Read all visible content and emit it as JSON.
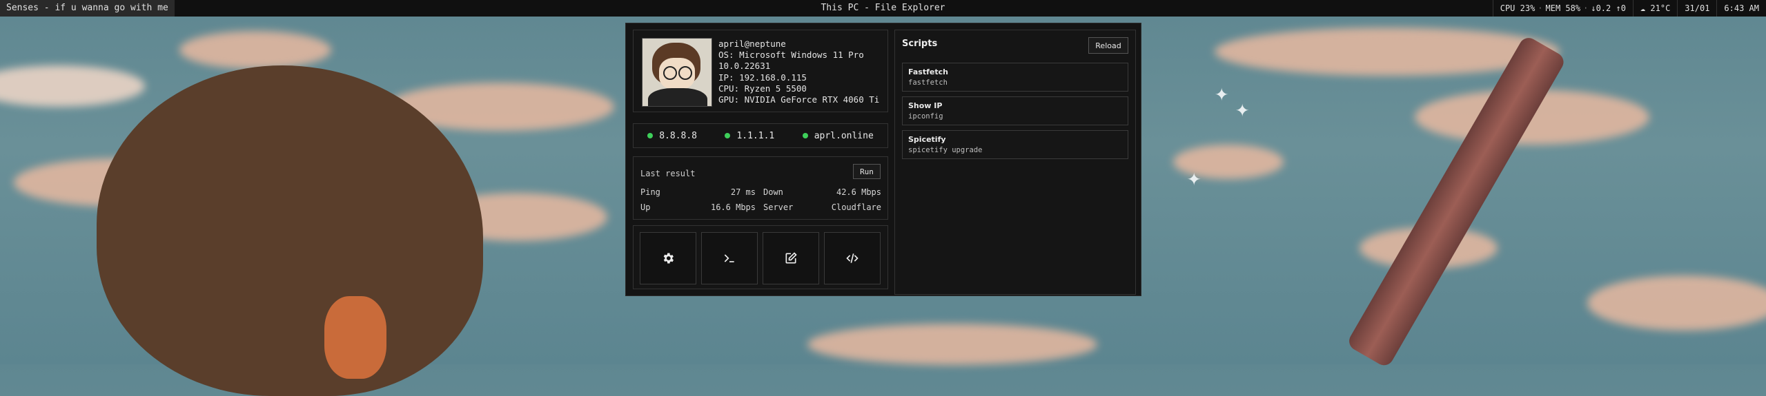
{
  "topbar": {
    "now_playing": "Senses - if u wanna go with me",
    "window_title": "This PC - File Explorer",
    "cpu": "CPU 23%",
    "mem": "MEM 58%",
    "network": "↓0.2 ↑0",
    "weather": "21°C",
    "date": "31/01",
    "time": "6:43 AM"
  },
  "sysinfo": {
    "user": "april@neptune",
    "os": "OS: Microsoft Windows 11 Pro",
    "build": "10.0.22631",
    "ip": "IP: 192.168.0.115",
    "cpu": "CPU: Ryzen 5 5500",
    "gpu": "GPU: NVIDIA GeForce RTX 4060 Ti"
  },
  "pings": [
    {
      "host": "8.8.8.8",
      "color": "#3ecf5a"
    },
    {
      "host": "1.1.1.1",
      "color": "#3ecf5a"
    },
    {
      "host": "aprl.online",
      "color": "#3ecf5a"
    }
  ],
  "speedtest": {
    "title": "Last result",
    "run_label": "Run",
    "ping_label": "Ping",
    "ping_value": "27 ms",
    "down_label": "Down",
    "down_value": "42.6 Mbps",
    "up_label": "Up",
    "up_value": "16.6 Mbps",
    "server_label": "Server",
    "server_value": "Cloudflare"
  },
  "actions": [
    {
      "icon": "gear-icon"
    },
    {
      "icon": "terminal-icon"
    },
    {
      "icon": "edit-icon"
    },
    {
      "icon": "code-icon"
    }
  ],
  "scripts": {
    "title": "Scripts",
    "reload_label": "Reload",
    "items": [
      {
        "name": "Fastfetch",
        "cmd": "fastfetch"
      },
      {
        "name": "Show IP",
        "cmd": "ipconfig"
      },
      {
        "name": "Spicetify",
        "cmd": "spicetify upgrade"
      }
    ]
  }
}
